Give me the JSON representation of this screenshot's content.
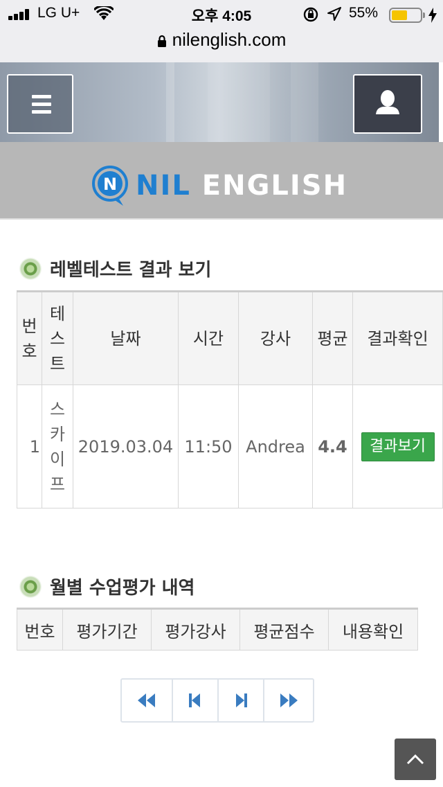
{
  "status_bar": {
    "carrier": "LG U+",
    "time": "오후 4:05",
    "battery_percent": "55%",
    "battery_level": 0.55
  },
  "browser": {
    "url": "nilenglish.com"
  },
  "header": {
    "logo_nil": "NIL",
    "logo_english": "ENGLISH",
    "logo_mark_letter": "N"
  },
  "level_test": {
    "title": "레벨테스트 결과 보기",
    "columns": {
      "number": [
        "번",
        "호"
      ],
      "test": [
        "테",
        "스",
        "트"
      ],
      "date": "날짜",
      "time": "시간",
      "teacher": "강사",
      "average": "평균",
      "result": "결과확인"
    },
    "rows": [
      {
        "number": "1",
        "test": [
          "스",
          "카",
          "이",
          "프"
        ],
        "date": "2019.03.04",
        "time": "11:50",
        "teacher": "Andrea",
        "average": "4.4",
        "result_button": "결과보기"
      }
    ]
  },
  "monthly_eval": {
    "title": "월별 수업평가 내역",
    "columns": [
      "번호",
      "평가기간",
      "평가강사",
      "평균점수",
      "내용확인"
    ]
  },
  "pagination": {
    "icons": [
      "first-page-icon",
      "prev-page-icon",
      "next-page-icon",
      "last-page-icon"
    ]
  },
  "colors": {
    "accent_blue": "#1f7fd0",
    "result_green": "#3aa64b",
    "average_green": "#6aa317",
    "pager_blue": "#3a7cc0"
  }
}
